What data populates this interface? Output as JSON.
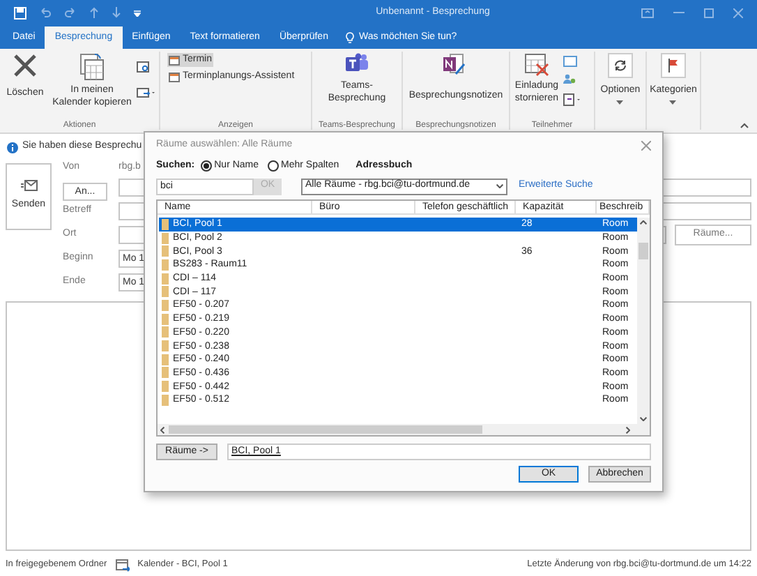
{
  "window": {
    "title": "Unbenannt - Besprechung"
  },
  "menu_tabs": [
    {
      "label": "Datei",
      "selected": false
    },
    {
      "label": "Besprechung",
      "selected": true
    },
    {
      "label": "Einfügen",
      "selected": false
    },
    {
      "label": "Text formatieren",
      "selected": false
    },
    {
      "label": "Überprüfen",
      "selected": false
    }
  ],
  "tell_me": "Was möchten Sie tun?",
  "ribbon": {
    "delete": "Löschen",
    "copy_calendar": "In meinen Kalender kopieren",
    "views": [
      {
        "label": "Termin",
        "selected": true
      },
      {
        "label": "Terminplanungs-Assistent",
        "selected": false
      }
    ],
    "teams": "Teams-Besprechung",
    "notes": "Besprechungsnotizen",
    "cancel_invite": "Einladung stornieren",
    "options": "Optionen",
    "categories": "Kategorien",
    "group_labels": [
      "Aktionen",
      "Anzeigen",
      "Teams-Besprechung",
      "Besprechungsnotizen",
      "Teilnehmer"
    ]
  },
  "form": {
    "info": "Sie haben diese Besprechu",
    "send": "Senden",
    "from_label": "Von",
    "from_value": "rbg.b",
    "to_button": "An...",
    "subject_label": "Betreff",
    "location_label": "Ort",
    "start_label": "Beginn",
    "start_value": "Mo 1",
    "end_label": "Ende",
    "end_value": "Mo 1",
    "rooms_button": "Räume..."
  },
  "dialog": {
    "title": "Räume auswählen: Alle Räume",
    "search_label": "Suchen:",
    "search_modes": [
      {
        "label": "Nur Name",
        "selected": true
      },
      {
        "label": "Mehr Spalten",
        "selected": false
      }
    ],
    "address_book_label": "Adressbuch",
    "query": "bci",
    "search_ok": {
      "label": "OK",
      "disabled": true
    },
    "address_book": "Alle Räume - rbg.bci@tu-dortmund.de",
    "advanced_search": "Erweiterte Suche",
    "columns": [
      "Name",
      "Büro",
      "Telefon geschäftlich",
      "Kapazität",
      "Beschreib"
    ],
    "rows": [
      {
        "name": "BCI, Pool 1",
        "capacity": "28",
        "description": "Room",
        "selected": true
      },
      {
        "name": "BCI, Pool 2",
        "description": "Room",
        "selected": false
      },
      {
        "name": "BCI, Pool 3",
        "capacity": "36",
        "description": "Room",
        "selected": false
      },
      {
        "name": "BS283 - Raum11",
        "description": "Room",
        "selected": false
      },
      {
        "name": "CDI – 114",
        "description": "Room",
        "selected": false
      },
      {
        "name": "CDI – 117",
        "description": "Room",
        "selected": false
      },
      {
        "name": "EF50 - 0.207",
        "description": "Room",
        "selected": false
      },
      {
        "name": "EF50 - 0.219",
        "description": "Room",
        "selected": false
      },
      {
        "name": "EF50 - 0.220",
        "description": "Room",
        "selected": false
      },
      {
        "name": "EF50 - 0.238",
        "description": "Room",
        "selected": false
      },
      {
        "name": "EF50 - 0.240",
        "description": "Room",
        "selected": false
      },
      {
        "name": "EF50 - 0.436",
        "description": "Room",
        "selected": false
      },
      {
        "name": "EF50 - 0.442",
        "description": "Room",
        "selected": false
      },
      {
        "name": "EF50 - 0.512",
        "description": "Room",
        "selected": false
      }
    ],
    "rooms_button": "Räume ->",
    "rooms_value": "BCI, Pool 1",
    "ok": "OK",
    "cancel": "Abbrechen"
  },
  "status_bar": {
    "folder": "In freigegebenem Ordner",
    "calendar": "Kalender - BCI, Pool 1",
    "modified": "Letzte Änderung von rbg.bci@tu-dortmund.de um 14:22"
  }
}
